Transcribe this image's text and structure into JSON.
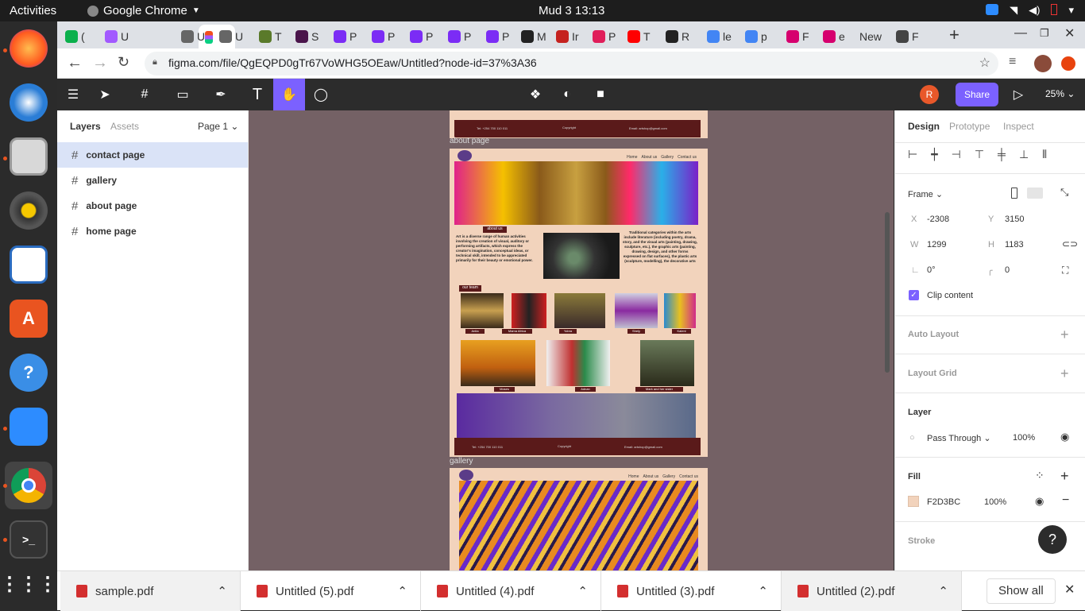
{
  "topbar": {
    "activities": "Activities",
    "app_name": "Google Chrome",
    "clock": "Mud 3  13:13"
  },
  "dock": {
    "items": [
      "firefox-icon",
      "thunderbird-icon",
      "files-icon",
      "rhythmbox-icon",
      "writer-icon",
      "software-icon",
      "help-icon",
      "zoom-icon",
      "chrome-icon",
      "terminal-icon",
      "app-grid-icon"
    ]
  },
  "tabs": [
    {
      "label": "(",
      "color": "#0bb04c"
    },
    {
      "label": "U",
      "color": "#a259ff"
    },
    {
      "label": "U",
      "color": "#666666"
    },
    {
      "label": "U",
      "color": "#666666"
    },
    {
      "label": "T",
      "color": "#5a7a2a"
    },
    {
      "label": "S",
      "color": "#4a154b"
    },
    {
      "label": "P",
      "color": "#7b2cf5"
    },
    {
      "label": "P",
      "color": "#7b2cf5"
    },
    {
      "label": "P",
      "color": "#7b2cf5"
    },
    {
      "label": "P",
      "color": "#7b2cf5"
    },
    {
      "label": "P",
      "color": "#7b2cf5"
    },
    {
      "label": "M",
      "color": "#222222"
    },
    {
      "label": "Ir",
      "color": "#c5221f"
    },
    {
      "label": "P",
      "color": "#e01e5a"
    },
    {
      "label": "T",
      "color": "#ff0000"
    },
    {
      "label": "R",
      "color": "#222222"
    },
    {
      "label": "le",
      "color": "#4285f4"
    },
    {
      "label": "p",
      "color": "#4285f4"
    },
    {
      "label": "F",
      "color": "#d6006e"
    },
    {
      "label": "e",
      "color": "#d6006e"
    },
    {
      "label": "New",
      "color": ""
    },
    {
      "label": "F",
      "color": "#444444"
    }
  ],
  "address": {
    "url": "figma.com/file/QgEQPD0gTr67VoWHG5OEaw/Untitled?node-id=37%3A36"
  },
  "figma_toolbar": {
    "share": "Share",
    "zoom": "25%",
    "avatar": "R"
  },
  "left_panel": {
    "tab_layers": "Layers",
    "tab_assets": "Assets",
    "page": "Page 1",
    "layers": [
      "contact page",
      "gallery",
      "about page",
      "home page"
    ]
  },
  "canvas": {
    "label_about": "about page",
    "label_gallery": "gallery",
    "nav": [
      "Home",
      "About us",
      "Gallery",
      "Contact us"
    ],
    "footer_tel": "Tel: +254 700 110 011",
    "footer_copy": "Copyright",
    "footer_email": "Email: artshop@gmail.com",
    "about_heading": "about us",
    "about_left": "Art is a diverse range of human activities involving the creation of visual, auditory or performing artifacts, which express the creator's imagination, conceptual ideas, or technical skill, intended to be appreciated primarily for their beauty or emotional power.",
    "about_right": "Traditional categories within the arts include literature (including poetry, drama, story, and the visual arts (painting, drawing, sculpture, etc.), the graphic arts (painting, drawing, design, and other forms expressed on flat surfaces), the plastic arts (sculpture, modelling), the decorative arts",
    "team_heading": "our team",
    "team_row1": [
      "Anita",
      "Mama Africa",
      "Yobra",
      "Shely",
      "Kaleni"
    ],
    "team_row2": [
      "Moses",
      "Adnan",
      "Mark and her sister"
    ]
  },
  "right_panel": {
    "tabs": [
      "Design",
      "Prototype",
      "Inspect"
    ],
    "frame_label": "Frame",
    "x_label": "X",
    "x": "-2308",
    "y_label": "Y",
    "y": "3150",
    "w_label": "W",
    "w": "1299",
    "h_label": "H",
    "h": "1183",
    "rotation": "0°",
    "radius": "0",
    "clip": "Clip content",
    "auto_layout": "Auto Layout",
    "layout_grid": "Layout Grid",
    "layer": "Layer",
    "blend": "Pass Through",
    "layer_opacity": "100%",
    "fill": "Fill",
    "fill_hex": "F2D3BC",
    "fill_opacity": "100%",
    "stroke": "Stroke",
    "help": "?"
  },
  "downloads": {
    "files": [
      "sample.pdf",
      "Untitled (5).pdf",
      "Untitled (4).pdf",
      "Untitled (3).pdf",
      "Untitled (2).pdf"
    ],
    "show_all": "Show all"
  }
}
